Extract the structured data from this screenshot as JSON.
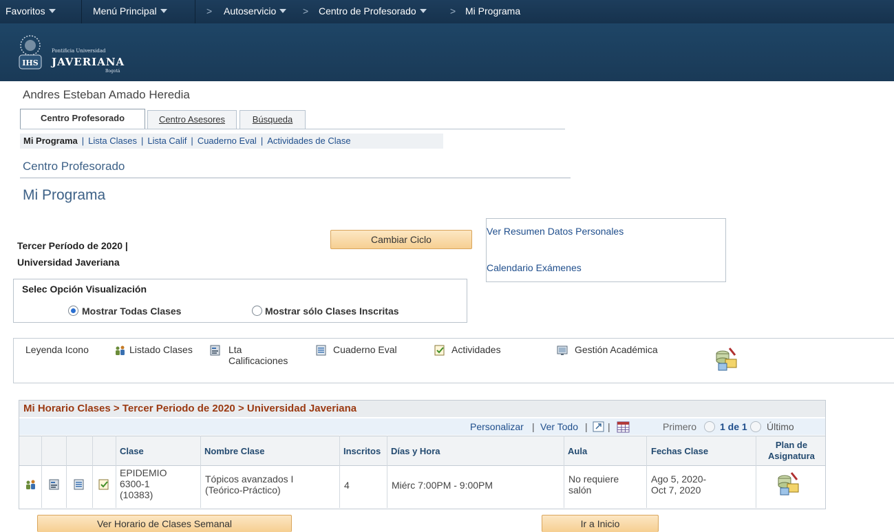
{
  "topnav": {
    "favorites": "Favoritos",
    "main_menu": "Menú Principal",
    "crumb_sep": ">",
    "autoservicio": "Autoservicio",
    "centro_prof": "Centro de Profesorado",
    "current": "Mi Programa"
  },
  "brand": {
    "small": "Pontificia Universidad",
    "name": "JAVERIANA",
    "city": "Bogotá",
    "crest_letters": "IHS"
  },
  "user_name": "Andres Esteban Amado Heredia",
  "tabs": [
    {
      "label": "Centro Profesorado"
    },
    {
      "label": "Centro Asesores"
    },
    {
      "label": "Búsqueda"
    }
  ],
  "subtabs": {
    "items": [
      "Mi Programa",
      "Lista Clases",
      "Lista Calif",
      "Cuaderno Eval",
      "Actividades de Clase"
    ],
    "separator": "|"
  },
  "section_title": "Centro Profesorado",
  "page_title": "Mi Programa",
  "term": {
    "line1": "Tercer Período de 2020 |",
    "line2": "Universidad Javeriana"
  },
  "buttons": {
    "change_term": "Cambiar Ciclo",
    "weekly": "Ver Horario de Clases Semanal",
    "home": "Ir a Inicio"
  },
  "links": {
    "personal_data": "Ver Resumen Datos Personales",
    "exam_calendar": "Calendario Exámenes"
  },
  "view_options": {
    "title": "Selec Opción Visualización",
    "all": "Mostrar Todas Clases",
    "enrolled": "Mostrar sólo Clases Inscritas",
    "selected": "all"
  },
  "legend": {
    "title": "Leyenda Icono",
    "class_list": "Listado Clases",
    "grade_list_1": "Lta",
    "grade_list_2": "Calificaciones",
    "gradebook": "Cuaderno Eval",
    "activities": "Actividades",
    "academic": "Gestión Académica"
  },
  "grid": {
    "title": "Mi Horario Clases > Tercer Periodo de 2020 > Universidad Javeriana",
    "personalize": "Personalizar",
    "view_all": "Ver Todo",
    "bar": "|",
    "first": "Primero",
    "page": "1 de 1",
    "last": "Último",
    "headers": {
      "clase": "Clase",
      "nombre": "Nombre Clase",
      "inscritos": "Inscritos",
      "dias": "Días y Hora",
      "aula": "Aula",
      "fechas": "Fechas Clase",
      "plan_1": "Plan de",
      "plan_2": "Asignatura"
    },
    "row": {
      "clase_1": "EPIDEMIO",
      "clase_2": "6300-1",
      "clase_3": "(10383)",
      "nombre_1": "Tópicos avanzados I",
      "nombre_2": "(Teórico-Práctico)",
      "inscritos": "4",
      "dias": "Miérc 7:00PM - 9:00PM",
      "aula_1": "No requiere",
      "aula_2": "salón",
      "fechas_1": "Ago 5, 2020-",
      "fechas_2": "Oct 7, 2020"
    }
  },
  "colors": {
    "header_bg": "#1d3d5c",
    "link": "#1f4e8c",
    "title": "#3d6187",
    "grid_title": "#9b3a12",
    "button": "#f6cf91"
  }
}
